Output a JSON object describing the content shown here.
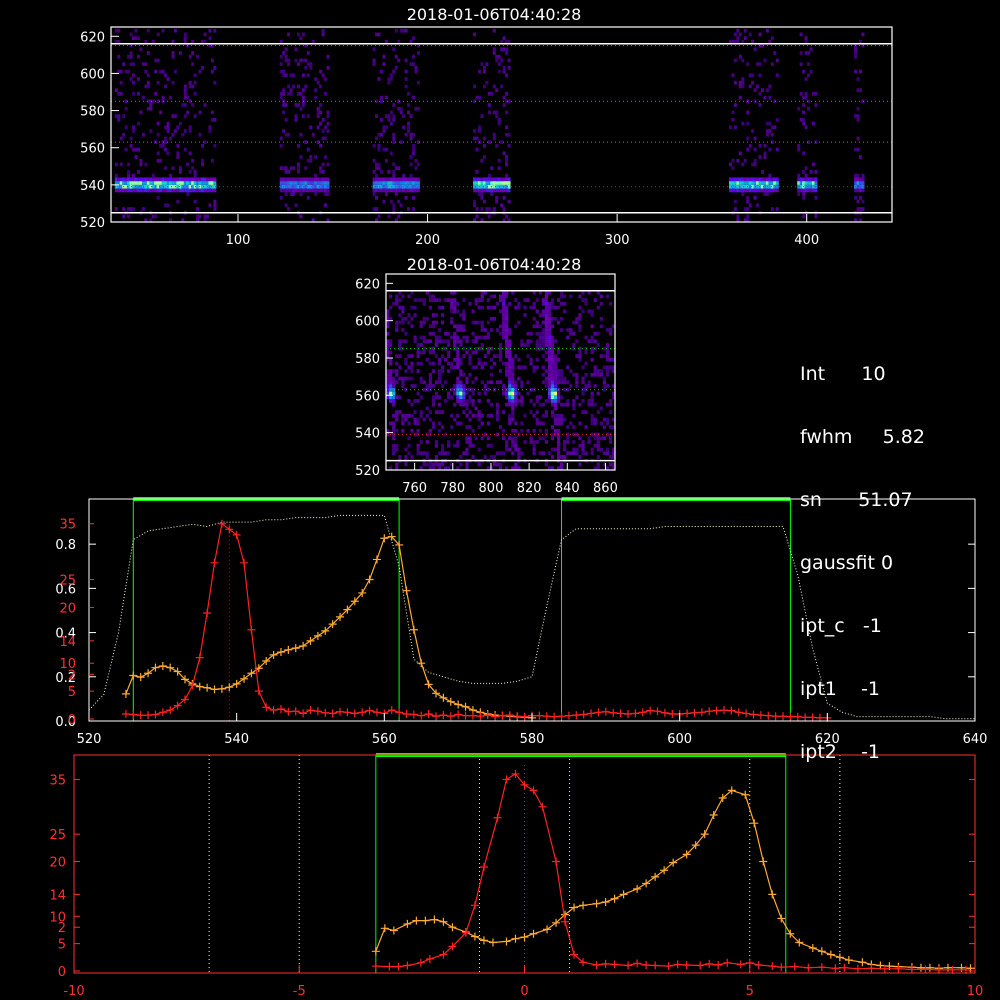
{
  "info": {
    "int_label": "Int",
    "int_value": "10",
    "fwhm_label": "fwhm",
    "fwhm_value": "5.82",
    "sn_label": "sn",
    "sn_value": "51.07",
    "gaussfit_label": "gaussfit",
    "gaussfit_value": "0",
    "ipt_c_label": "ipt_c",
    "ipt_c_value": "-1",
    "ipt1_label": "ipt1",
    "ipt1_value": "-1",
    "ipt2_label": "ipt2",
    "ipt2_value": "-1"
  },
  "colors": {
    "frame": "#ffffff",
    "green": "#00ff00",
    "red_curve": "#ff2020",
    "orange_curve": "#ffaa33",
    "axis_red": "#ff3030",
    "dotted_white": "#ffffcc",
    "grid_green": "#00cc00",
    "grid_red": "#cc2020"
  },
  "chart_data": [
    {
      "type": "heatmap",
      "id": "spectrogram-full",
      "title": "2018-01-06T04:40:28",
      "xlim": [
        33,
        445
      ],
      "ylim": [
        520,
        625
      ],
      "xticks": [
        100,
        200,
        300,
        400
      ],
      "yticks": [
        520,
        540,
        560,
        580,
        600,
        620
      ],
      "white_hlines": [
        525,
        616
      ],
      "green_hlines": [
        563,
        585,
        615
      ],
      "red_hlines": [
        539
      ],
      "bands": [
        {
          "x": [
            35,
            88
          ],
          "peak": 1.0
        },
        {
          "x": [
            122,
            148
          ],
          "peak": 0.7
        },
        {
          "x": [
            171,
            195
          ],
          "peak": 0.75
        },
        {
          "x": [
            224,
            243
          ],
          "peak": 1.0
        },
        {
          "x": [
            359,
            385
          ],
          "peak": 0.95
        },
        {
          "x": [
            395,
            405
          ],
          "peak": 0.9
        },
        {
          "x": [
            425,
            430
          ],
          "peak": 0.7
        }
      ]
    },
    {
      "type": "heatmap",
      "id": "spectrogram-zoom",
      "title": "2018-01-06T04:40:28",
      "xlim": [
        745,
        865
      ],
      "ylim": [
        520,
        625
      ],
      "xticks": [
        760,
        780,
        800,
        820,
        840,
        860
      ],
      "yticks": [
        520,
        540,
        560,
        580,
        600,
        620
      ],
      "white_hlines": [
        525,
        616
      ],
      "green_hlines": [
        563,
        585
      ],
      "red_hlines": [
        539
      ],
      "streaks": [
        {
          "x": 747,
          "peak": 0.8
        },
        {
          "x": 783,
          "peak": 0.8
        },
        {
          "x": 810,
          "peak": 0.95
        },
        {
          "x": 832,
          "peak": 1.0
        }
      ]
    },
    {
      "type": "line",
      "id": "spectrum-plot",
      "xlim": [
        520,
        640
      ],
      "xticks": [
        520,
        540,
        560,
        580,
        600,
        620,
        640
      ],
      "left_white_ticks": [
        0.0,
        0.2,
        0.4,
        0.6,
        0.8
      ],
      "left_white_ylim": [
        0,
        0.95
      ],
      "left_red_ticks": [
        "0",
        "5",
        "10",
        "15",
        "20",
        "25",
        "30"
      ],
      "left_red_display": [
        "0",
        "5",
        "2",
        "10",
        "14",
        "20",
        "25",
        "35"
      ],
      "red_ylim": [
        0,
        38
      ],
      "green_boxes": [
        [
          526,
          562
        ],
        [
          584,
          615
        ]
      ],
      "series": [
        {
          "name": "",
          "color": "#ff2020",
          "x": [
            525,
            526,
            527,
            528,
            529,
            530,
            531,
            532,
            533,
            534,
            535,
            536,
            537,
            538,
            539,
            540,
            541,
            542,
            543,
            544,
            545,
            546,
            547,
            548,
            549,
            550,
            551,
            552,
            553,
            554,
            555,
            556,
            557,
            558,
            559,
            560,
            561,
            562,
            563,
            564,
            565,
            566,
            567,
            568,
            569,
            570,
            571,
            572,
            573,
            574,
            575,
            576,
            577,
            578,
            579,
            580,
            581,
            582,
            583,
            584,
            585,
            586,
            587,
            588,
            589,
            590,
            591,
            592,
            593,
            594,
            595,
            596,
            597,
            598,
            599,
            600,
            601,
            602,
            603,
            604,
            605,
            606,
            607,
            608,
            609,
            610,
            611,
            612,
            613,
            614,
            615,
            616,
            617,
            618,
            619,
            620
          ],
          "y": [
            0.9,
            0.8,
            0.7,
            0.7,
            0.8,
            1.2,
            1.6,
            2.4,
            3.5,
            6,
            11,
            19,
            28,
            35,
            34,
            33,
            28,
            16,
            5,
            2.1,
            1.6,
            1.8,
            1.3,
            1.4,
            1.0,
            1.6,
            1.4,
            1.1,
            1.0,
            1.3,
            1.2,
            1.0,
            1.2,
            1.5,
            1.2,
            1.0,
            1.6,
            1.2,
            0.9,
            0.8,
            0.6,
            0.9,
            0.5,
            0.7,
            0.5,
            0.8,
            0.6,
            0.6,
            0.5,
            0.7,
            0.4,
            0.6,
            0.7,
            0.5,
            0.4,
            0.6,
            0.6,
            0.5,
            0.4,
            0.5,
            0.6,
            0.7,
            0.8,
            1.0,
            1.2,
            1.3,
            1.1,
            1.0,
            0.9,
            1.0,
            1.2,
            1.5,
            1.4,
            1.1,
            0.9,
            0.9,
            1.0,
            1.1,
            1.2,
            1.4,
            1.5,
            1.6,
            1.5,
            1.2,
            1.0,
            0.8,
            0.7,
            0.6,
            0.5,
            0.5,
            0.4,
            0.4,
            0.3,
            0.3,
            0.2,
            0.2
          ]
        },
        {
          "name": "",
          "color": "#ffaa33",
          "x": [
            525,
            526,
            527,
            528,
            529,
            530,
            531,
            532,
            533,
            534,
            535,
            536,
            537,
            538,
            539,
            540,
            541,
            542,
            543,
            544,
            545,
            546,
            547,
            548,
            549,
            550,
            551,
            552,
            553,
            554,
            555,
            556,
            557,
            558,
            559,
            560,
            561,
            562,
            563,
            564,
            565,
            566,
            567,
            568,
            569,
            570,
            571,
            572,
            573,
            574,
            575,
            576,
            577,
            578,
            579,
            580
          ],
          "y": [
            4.5,
            7.8,
            7.5,
            8.2,
            9.2,
            9.5,
            9.2,
            8.5,
            7.1,
            6.3,
            5.8,
            5.6,
            5.3,
            5.4,
            5.7,
            6.3,
            7.2,
            8.2,
            9.1,
            10.4,
            11.5,
            12,
            12.4,
            12.7,
            13.1,
            14,
            14.9,
            15.8,
            17,
            18.3,
            19.6,
            21.1,
            22.6,
            25,
            28.6,
            32.4,
            32.7,
            31.2,
            23,
            16,
            10,
            6.2,
            4.6,
            3.8,
            3.1,
            2.6,
            2.2,
            1.6,
            1.2,
            0.9,
            0.7,
            0.6,
            0.5,
            0.4,
            0.3,
            0.2
          ]
        },
        {
          "name": "",
          "color": "#ffffcc",
          "axis": "white",
          "x": [
            520,
            522,
            524,
            526,
            528,
            530,
            532,
            534,
            536,
            538,
            540,
            542,
            544,
            546,
            548,
            550,
            552,
            554,
            556,
            558,
            560,
            562,
            564,
            566,
            568,
            570,
            572,
            574,
            576,
            578,
            580,
            582,
            584,
            586,
            588,
            590,
            592,
            594,
            596,
            598,
            600,
            602,
            604,
            606,
            608,
            610,
            612,
            614,
            616,
            618,
            620,
            622,
            624,
            626,
            628,
            630,
            632,
            634,
            636,
            638,
            640
          ],
          "y": [
            0.05,
            0.12,
            0.4,
            0.82,
            0.86,
            0.87,
            0.88,
            0.89,
            0.88,
            0.9,
            0.9,
            0.9,
            0.91,
            0.91,
            0.92,
            0.92,
            0.92,
            0.93,
            0.93,
            0.93,
            0.93,
            0.7,
            0.28,
            0.22,
            0.2,
            0.18,
            0.17,
            0.17,
            0.17,
            0.18,
            0.2,
            0.52,
            0.82,
            0.87,
            0.87,
            0.87,
            0.87,
            0.87,
            0.87,
            0.88,
            0.88,
            0.88,
            0.88,
            0.88,
            0.88,
            0.88,
            0.88,
            0.88,
            0.66,
            0.33,
            0.08,
            0.04,
            0.02,
            0.02,
            0.02,
            0.02,
            0.02,
            0.02,
            0.01,
            0.01,
            0.01
          ]
        }
      ]
    },
    {
      "type": "line",
      "id": "velocity-plot",
      "xlim": [
        -10,
        10
      ],
      "xticks": [
        -10,
        -5,
        0,
        5,
        10
      ],
      "left_red_display": [
        "0",
        "5",
        "2",
        "10",
        "14",
        "20",
        "25",
        "35"
      ],
      "red_ylim": [
        0,
        38
      ],
      "green_box": [
        -3.3,
        5.8
      ],
      "dotted_white_vlines": [
        -7,
        -5,
        -1,
        1,
        5,
        7
      ],
      "dotted_red_vlines": [
        0
      ],
      "series": [
        {
          "name": "",
          "color": "#ff2020",
          "x": [
            -3.3,
            -3.0,
            -2.8,
            -2.6,
            -2.3,
            -2.1,
            -1.8,
            -1.6,
            -1.3,
            -1.1,
            -0.9,
            -0.6,
            -0.4,
            -0.2,
            0.0,
            0.2,
            0.4,
            0.7,
            0.9,
            1.1,
            1.3,
            1.6,
            1.8,
            2.0,
            2.3,
            2.5,
            2.7,
            2.9,
            3.2,
            3.4,
            3.6,
            3.9,
            4.1,
            4.3,
            4.5,
            4.8,
            5.0,
            5.2,
            5.5,
            5.7,
            6.0,
            6.3,
            6.6,
            6.9,
            7.1,
            7.4,
            7.7,
            8.0,
            8.3,
            8.6,
            8.9,
            9.2,
            9.5,
            9.8
          ],
          "y": [
            0.9,
            0.8,
            0.8,
            1.0,
            1.5,
            2.2,
            3.0,
            4.5,
            7,
            12,
            19,
            28,
            35,
            36,
            34,
            33,
            30,
            20,
            9,
            3,
            1.6,
            1.1,
            1.3,
            1.2,
            1.0,
            1.4,
            1.1,
            1.0,
            0.9,
            1.2,
            1.1,
            1.0,
            1.3,
            1.1,
            1.5,
            1.2,
            1.5,
            1.1,
            0.9,
            0.7,
            0.8,
            0.6,
            0.7,
            0.5,
            0.6,
            0.4,
            0.5,
            0.4,
            0.4,
            0.3,
            0.3,
            0.2,
            0.2,
            0.2
          ]
        },
        {
          "name": "",
          "color": "#ffaa33",
          "x": [
            -3.3,
            -3.1,
            -2.9,
            -2.6,
            -2.4,
            -2.2,
            -2.0,
            -1.8,
            -1.6,
            -1.3,
            -1.1,
            -0.9,
            -0.7,
            -0.4,
            -0.2,
            0.0,
            0.2,
            0.5,
            0.7,
            0.9,
            1.1,
            1.3,
            1.6,
            1.8,
            2.0,
            2.2,
            2.5,
            2.7,
            2.9,
            3.1,
            3.3,
            3.6,
            3.8,
            4.0,
            4.2,
            4.4,
            4.6,
            4.9,
            5.1,
            5.3,
            5.5,
            5.7,
            5.9,
            6.1,
            6.4,
            6.6,
            6.8,
            7.0,
            7.2,
            7.5,
            7.7,
            7.9,
            8.1,
            8.3,
            8.6,
            8.8,
            9.0,
            9.2,
            9.4,
            9.7,
            9.9
          ],
          "y": [
            3.6,
            7.8,
            7.4,
            8.6,
            9.2,
            9.2,
            9.4,
            9.0,
            8.0,
            7.1,
            6.3,
            5.6,
            5.2,
            5.4,
            5.9,
            6.2,
            6.8,
            7.6,
            8.8,
            10.3,
            11.6,
            12,
            12.3,
            12.6,
            13.2,
            14,
            15,
            16,
            17.2,
            18.4,
            19.8,
            21.3,
            23,
            25,
            28.5,
            31.6,
            33,
            32.2,
            27,
            20,
            14,
            9.6,
            6.8,
            5.2,
            4.2,
            3.6,
            3.0,
            2.5,
            2.0,
            1.6,
            1.2,
            1.0,
            0.9,
            0.8,
            0.7,
            0.6,
            0.6,
            0.5,
            0.6,
            0.6,
            0.5
          ]
        }
      ]
    }
  ]
}
